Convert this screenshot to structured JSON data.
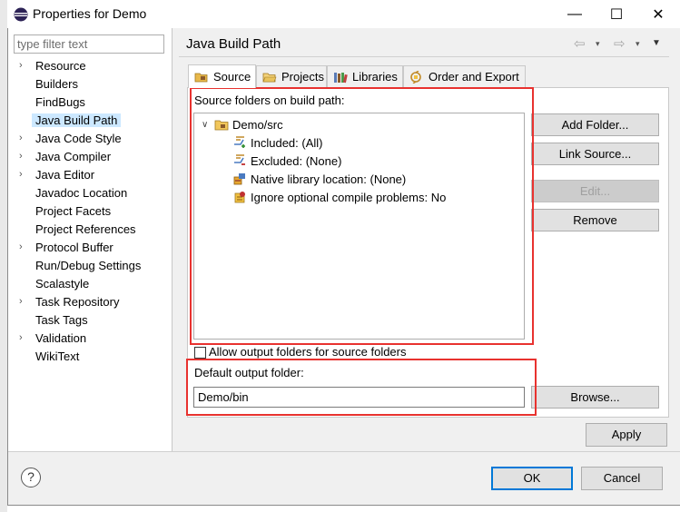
{
  "window": {
    "title": "Properties for Demo"
  },
  "filter": {
    "placeholder": "type filter text"
  },
  "nav": [
    {
      "label": "Resource",
      "expandable": true
    },
    {
      "label": "Builders",
      "expandable": false
    },
    {
      "label": "FindBugs",
      "expandable": false
    },
    {
      "label": "Java Build Path",
      "expandable": false,
      "selected": true
    },
    {
      "label": "Java Code Style",
      "expandable": true
    },
    {
      "label": "Java Compiler",
      "expandable": true
    },
    {
      "label": "Java Editor",
      "expandable": true
    },
    {
      "label": "Javadoc Location",
      "expandable": false
    },
    {
      "label": "Project Facets",
      "expandable": false
    },
    {
      "label": "Project References",
      "expandable": false
    },
    {
      "label": "Protocol Buffer",
      "expandable": true
    },
    {
      "label": "Run/Debug Settings",
      "expandable": false
    },
    {
      "label": "Scalastyle",
      "expandable": false
    },
    {
      "label": "Task Repository",
      "expandable": true
    },
    {
      "label": "Task Tags",
      "expandable": false
    },
    {
      "label": "Validation",
      "expandable": true
    },
    {
      "label": "WikiText",
      "expandable": false
    }
  ],
  "page": {
    "title": "Java Build Path"
  },
  "tabs": [
    {
      "label": "Source",
      "active": true
    },
    {
      "label": "Projects",
      "active": false
    },
    {
      "label": "Libraries",
      "active": false
    },
    {
      "label": "Order and Export",
      "active": false
    }
  ],
  "source": {
    "label": "Source folders on build path:",
    "tree": {
      "root": "Demo/src",
      "children": [
        "Included: (All)",
        "Excluded: (None)",
        "Native library location: (None)",
        "Ignore optional compile problems: No"
      ]
    },
    "buttons": {
      "add_folder": "Add Folder...",
      "link_source": "Link Source...",
      "edit": "Edit...",
      "remove": "Remove"
    },
    "allow_output_label": "Allow output folders for source folders",
    "allow_output_checked": false,
    "output_label": "Default output folder:",
    "output_value": "Demo/bin",
    "browse": "Browse..."
  },
  "footer": {
    "apply": "Apply",
    "ok": "OK",
    "cancel": "Cancel",
    "help_glyph": "?"
  },
  "colors": {
    "highlight": "#e8322f",
    "selection": "#cce8ff",
    "default_button_border": "#0078d7"
  },
  "titlebar_icons": {
    "minimize": "—",
    "maximize": "☐",
    "close": "✕"
  },
  "header_icons": {
    "back": "⇦",
    "forward": "⇨",
    "dropdown": "▾",
    "view_menu": "▼"
  }
}
